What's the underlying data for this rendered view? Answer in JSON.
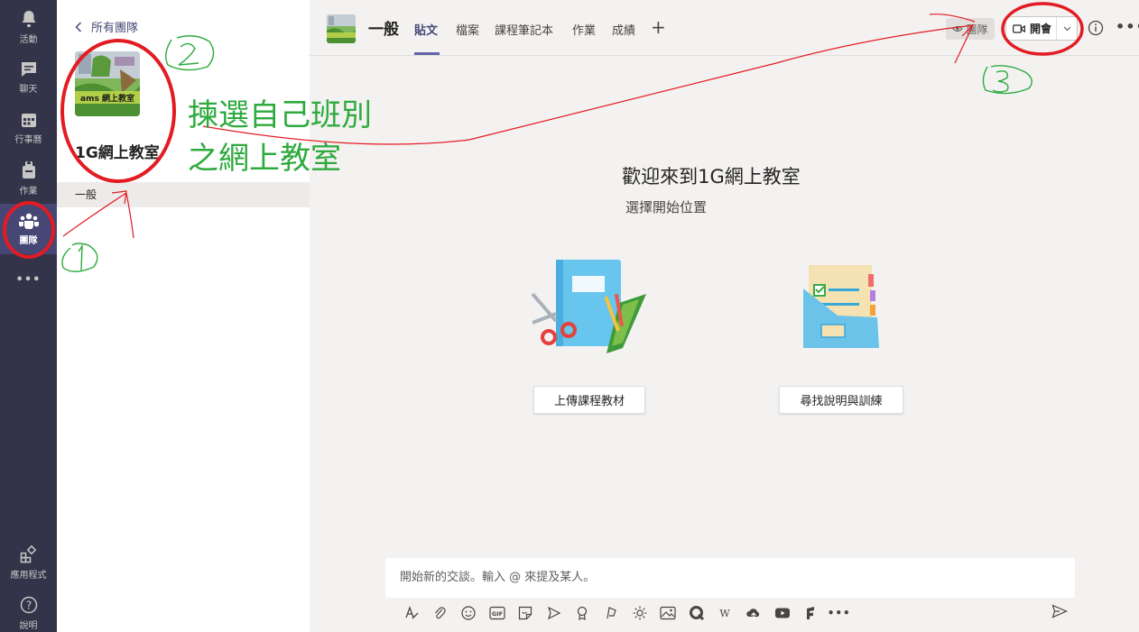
{
  "rail": {
    "items": [
      {
        "label": "活動",
        "icon": "bell-icon"
      },
      {
        "label": "聊天",
        "icon": "chat-icon"
      },
      {
        "label": "行事曆",
        "icon": "calendar-icon"
      },
      {
        "label": "作業",
        "icon": "assignment-icon"
      },
      {
        "label": "團隊",
        "icon": "teams-icon",
        "active": true
      }
    ],
    "more": "•••",
    "apps_label": "應用程式",
    "help_label": "說明"
  },
  "team_panel": {
    "back_label": "所有團隊",
    "avatar_text": "ams 網上教室",
    "team_name": "1G網上教室",
    "channel": "一般"
  },
  "header": {
    "channel_title": "一般",
    "tabs": [
      "貼文",
      "檔案",
      "課程筆記本",
      "作業",
      "成績"
    ],
    "add_tab": "+",
    "team_chip": "團隊",
    "meet_label": "開會",
    "more": "•••"
  },
  "main": {
    "welcome_title": "歡迎來到1G網上教室",
    "welcome_subtitle": "選擇開始位置",
    "upload_button": "上傳課程教材",
    "help_button": "尋找說明與訓練"
  },
  "compose": {
    "placeholder": "開始新的交談。輸入 @ 來提及某人。",
    "gif_label": "GIF"
  },
  "annotations": {
    "instruction_line1": "揀選自己班別",
    "instruction_line2": "之網上教室",
    "color": "#2eaa3e",
    "circle_color": "#e31b23"
  },
  "colors": {
    "rail_bg": "#33344a",
    "accent": "#6264a7"
  }
}
